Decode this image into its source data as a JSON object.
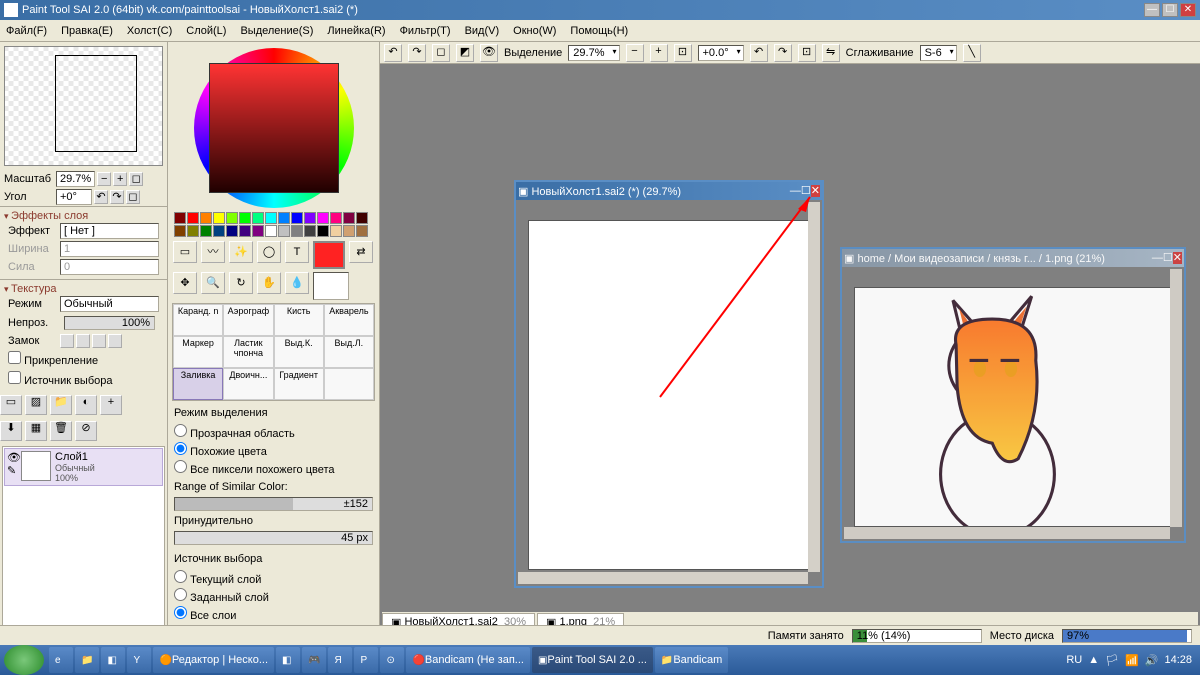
{
  "titlebar": {
    "text": "Paint Tool SAI 2.0 (64bit) vk.com/painttoolsai - НовыйХолст1.sai2 (*)"
  },
  "menu": [
    "Файл(F)",
    "Правка(E)",
    "Холст(C)",
    "Слой(L)",
    "Выделение(S)",
    "Линейка(R)",
    "Фильтр(T)",
    "Вид(V)",
    "Окно(W)",
    "Помощь(H)"
  ],
  "left": {
    "scale_label": "Масштаб",
    "scale": "29.7%",
    "angle_label": "Угол",
    "angle": "+0°",
    "effects_h": "Эффекты слоя",
    "effect_label": "Эффект",
    "effect_val": "[ Нет ]",
    "width_label": "Ширина",
    "width_val": "1",
    "power_label": "Сила",
    "power_val": "0",
    "texture_h": "Текстура",
    "mode_label": "Режим",
    "mode_val": "Обычный",
    "opacity_label": "Непроз.",
    "opacity_val": "100%",
    "lock_label": "Замок",
    "pin_label": "Прикрепление",
    "source_label": "Источник выбора",
    "layer": {
      "name": "Слой1",
      "mode": "Обычный",
      "opacity": "100%"
    }
  },
  "mid": {
    "swatches": [
      "#800000",
      "#ff0000",
      "#ff8000",
      "#ffff00",
      "#80ff00",
      "#00ff00",
      "#00ff80",
      "#00ffff",
      "#0080ff",
      "#0000ff",
      "#8000ff",
      "#ff00ff",
      "#ff0080",
      "#800040",
      "#400000",
      "#804000",
      "#808000",
      "#008000",
      "#004080",
      "#000080",
      "#400080",
      "#800080",
      "#ffffff",
      "#c0c0c0",
      "#808080",
      "#404040",
      "#000000",
      "#f0d0a0",
      "#d0a070",
      "#a07040"
    ],
    "brushes": [
      "Каранд. n",
      "Аэрограф",
      "Кисть",
      "Акварель",
      "Маркер",
      "Ластик чпонча",
      "Выд.К.",
      "Выд.Л.",
      "Заливка",
      "Двоичн...",
      "Градиент",
      ""
    ],
    "selmode_h": "Режим выделения",
    "selmode": [
      "Прозрачная область",
      "Похожие цвета",
      "Все пиксели похожего цвета"
    ],
    "range_label": "Range of Similar Color:",
    "range_val": "±152",
    "force_label": "Принудительно",
    "force_val": "45 px",
    "source_h": "Источник выбора",
    "source": [
      "Текущий слой",
      "Заданный слой",
      "Все слои"
    ]
  },
  "top": {
    "sel_label": "Выделение",
    "zoom": "29.7%",
    "rot": "+0.0°",
    "smooth_label": "Сглаживание",
    "smooth_val": "S-6"
  },
  "win1": {
    "title": "НовыйХолст1.sai2 (*) (29.7%)"
  },
  "win2": {
    "title": "home / Мои видеозаписи / князь г... / 1.png (21%)"
  },
  "tabs": [
    {
      "name": "НовыйХолст1.sai2",
      "pct": "30%"
    },
    {
      "name": "1.png",
      "pct": "21%"
    }
  ],
  "status": {
    "mem_label": "Памяти занято",
    "mem_val": "11% (14%)",
    "disk_label": "Место диска",
    "disk_val": "97%"
  },
  "taskbar": {
    "items": [
      "Редактор | Неско...",
      "",
      "",
      "",
      "",
      "",
      "",
      "Bandicam (Не зап...",
      "Paint Tool SAI 2.0 ...",
      "Bandicam"
    ],
    "lang": "RU",
    "time": "14:28"
  }
}
